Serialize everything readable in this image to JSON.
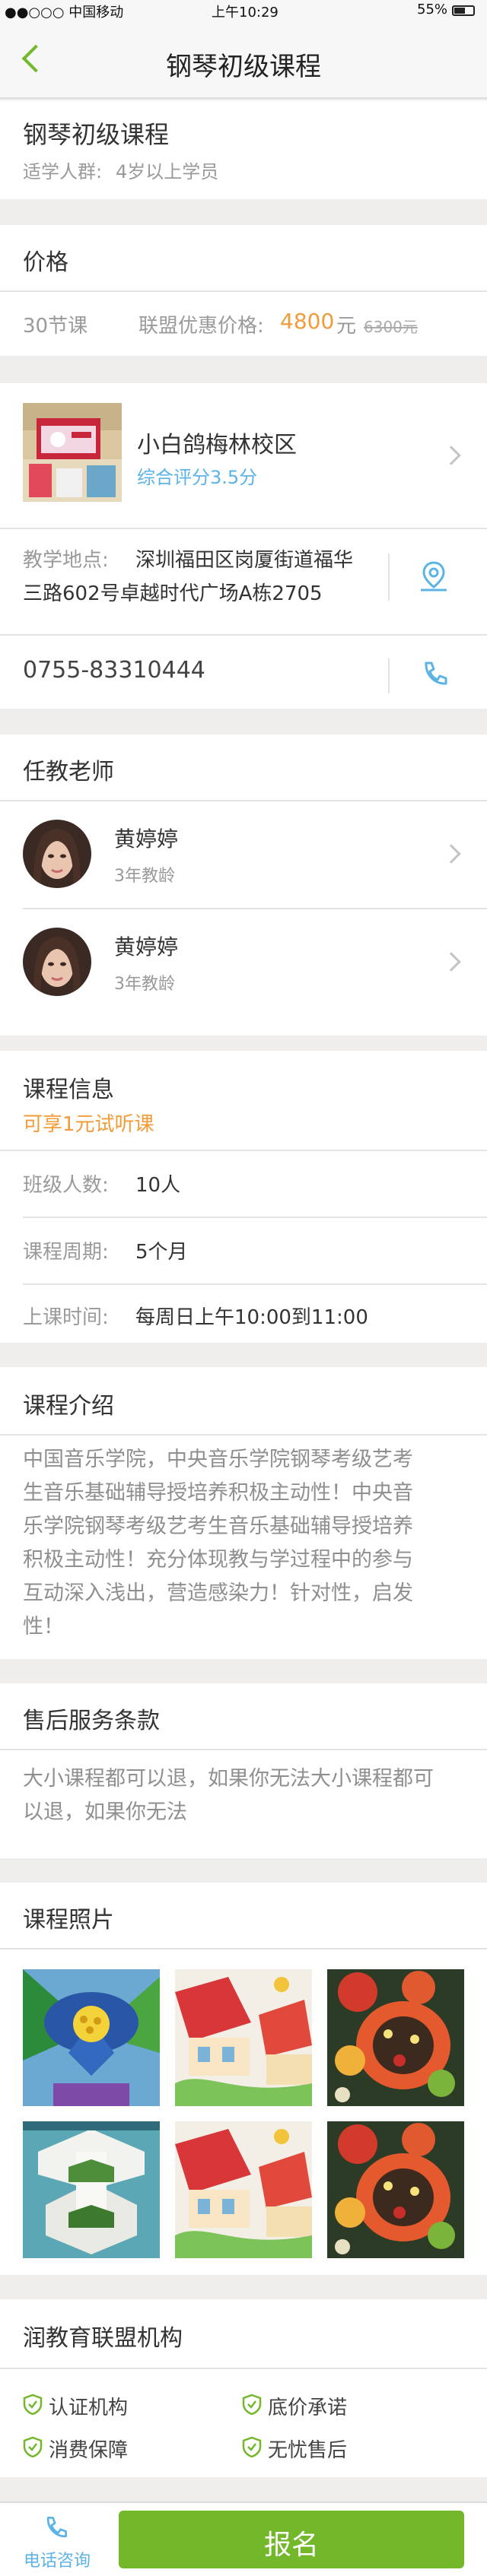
{
  "status_bar": {
    "carrier": "●●○○○ 中国移动",
    "time": "上午10:29",
    "battery": "55%"
  },
  "nav": {
    "title": "钢琴初级课程"
  },
  "course": {
    "name": "钢琴初级课程",
    "audience_label": "适学人群:",
    "audience_value": "4岁以上学员"
  },
  "price": {
    "section_title": "价格",
    "lessons": "30节课",
    "promo_label": "联盟优惠价格:",
    "promo_value": "4800",
    "promo_unit": "元",
    "original": "6300元"
  },
  "school": {
    "name": "小白鸽梅林校区",
    "rating": "综合评分3.5分",
    "address_label": "教学地点:",
    "address_line1": "深圳福田区岗厦街道福华",
    "address_line2": "三路602号卓越时代广场A栋2705",
    "phone": "0755-83310444"
  },
  "teachers": {
    "section_title": "任教老师",
    "items": [
      {
        "name": "黄婷婷",
        "years": "3年教龄"
      },
      {
        "name": "黄婷婷",
        "years": "3年教龄"
      }
    ]
  },
  "info": {
    "section_title": "课程信息",
    "trial": "可享1元试听课",
    "class_size_label": "班级人数:",
    "class_size_value": "10人",
    "period_label": "课程周期:",
    "period_value": "5个月",
    "schedule_label": "上课时间:",
    "schedule_value": "每周日上午10:00到11:00"
  },
  "intro": {
    "section_title": "课程介绍",
    "lines": [
      "中国音乐学院，中央音乐学院钢琴考级艺考",
      "生音乐基础辅导授培养积极主动性！中央音",
      "乐学院钢琴考级艺考生音乐基础辅导授培养",
      "积极主动性！充分体现教与学过程中的参与",
      "互动深入浅出，营造感染力！针对性，启发",
      "性！"
    ]
  },
  "after_sale": {
    "section_title": "售后服务条款",
    "lines": [
      "大小课程都可以退，如果你无法大小课程都可",
      "以退，如果你无法"
    ]
  },
  "photos": {
    "section_title": "课程照片"
  },
  "alliance": {
    "section_title": "润教育联盟机构",
    "badges": [
      "认证机构",
      "底价承诺",
      "消费保障",
      "无忧售后"
    ]
  },
  "bottom_bar": {
    "consult": "电话咨询",
    "signup": "报名"
  },
  "colors": {
    "accent_green": "#73b82a",
    "price_orange": "#f29b39",
    "link_blue": "#5cb3e6"
  }
}
